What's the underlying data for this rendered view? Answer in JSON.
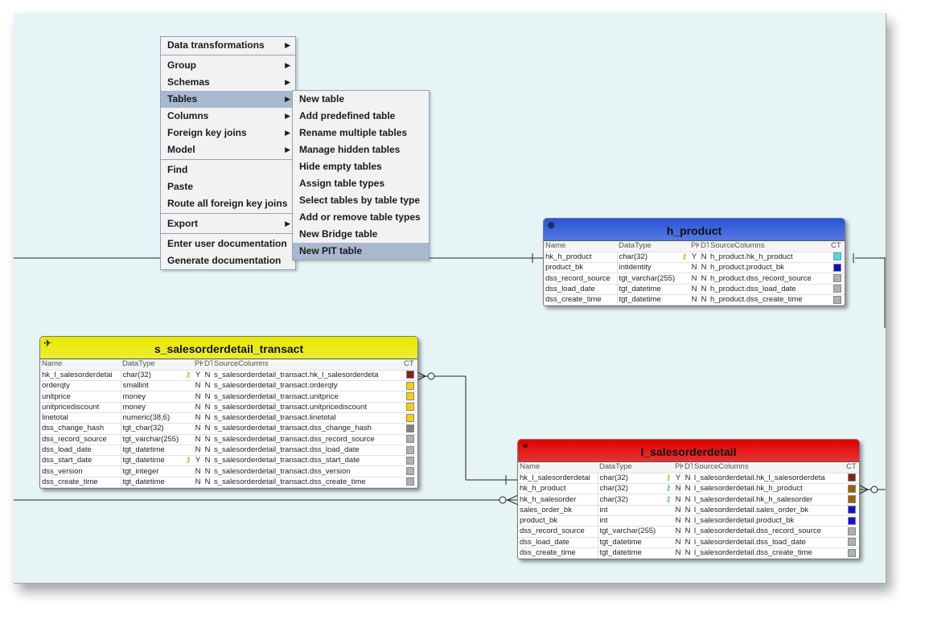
{
  "main_menu": {
    "items": [
      {
        "label": "Data transformations",
        "submenu": true
      },
      {
        "sep": true
      },
      {
        "label": "Group",
        "submenu": true
      },
      {
        "label": "Schemas",
        "submenu": true
      },
      {
        "label": "Tables",
        "submenu": true,
        "highlight": true
      },
      {
        "label": "Columns",
        "submenu": true
      },
      {
        "label": "Foreign key joins",
        "submenu": true
      },
      {
        "label": "Model",
        "submenu": true
      },
      {
        "sep": true
      },
      {
        "label": "Find"
      },
      {
        "label": "Paste"
      },
      {
        "label": "Route all foreign key joins"
      },
      {
        "sep": true
      },
      {
        "label": "Export",
        "submenu": true
      },
      {
        "sep": true
      },
      {
        "label": "Enter user documentation"
      },
      {
        "label": "Generate documentation"
      }
    ]
  },
  "tables_submenu": {
    "items": [
      {
        "label": "New table"
      },
      {
        "label": "Add predefined table"
      },
      {
        "label": "Rename multiple tables"
      },
      {
        "label": "Manage hidden tables"
      },
      {
        "label": "Hide empty tables"
      },
      {
        "label": "Assign table types"
      },
      {
        "label": "Select tables by table type"
      },
      {
        "label": "Add or remove table types"
      },
      {
        "label": "New Bridge table"
      },
      {
        "label": "New PIT table",
        "highlight": true
      }
    ]
  },
  "entities": {
    "h_product": {
      "title": "h_product",
      "header_color": "#2a55d8",
      "icon": "globe-icon",
      "columns": [
        "Name",
        "DataType",
        "PK",
        "DT",
        "SourceColumns",
        "CT"
      ],
      "rows": [
        {
          "name": "hk_h_product",
          "type": "char(32)",
          "key": "gold",
          "pk": "Y",
          "dt": "N",
          "src": "h_product.hk_h_product",
          "ct": "#40e0e8"
        },
        {
          "name": "product_bk",
          "type": "intidentity",
          "key": "",
          "pk": "N",
          "dt": "N",
          "src": "h_product.product_bk",
          "ct": "#1010c0"
        },
        {
          "name": "dss_record_source",
          "type": "tgt_varchar(255)",
          "key": "",
          "pk": "N",
          "dt": "N",
          "src": "h_product.dss_record_source",
          "ct": "#b0b0b0"
        },
        {
          "name": "dss_load_date",
          "type": "tgt_datetime",
          "key": "",
          "pk": "N",
          "dt": "N",
          "src": "h_product.dss_load_date",
          "ct": "#b0b0b0"
        },
        {
          "name": "dss_create_time",
          "type": "tgt_datetime",
          "key": "",
          "pk": "N",
          "dt": "N",
          "src": "h_product.dss_create_time",
          "ct": "#b0b0b0"
        }
      ]
    },
    "s_sales": {
      "title": "s_salesorderdetail_transact",
      "header_color": "#e8e800",
      "icon": "satellite-icon",
      "columns": [
        "Name",
        "DataType",
        "PK",
        "DT",
        "SourceColumns",
        "CT"
      ],
      "rows": [
        {
          "name": "hk_l_salesorderdetai",
          "type": "char(32)",
          "key": "gold",
          "pk": "Y",
          "dt": "N",
          "src": "s_salesorderdetail_transact.hk_l_salesorderdeta",
          "ct": "#8b2010"
        },
        {
          "name": "orderqty",
          "type": "smallint",
          "key": "",
          "pk": "N",
          "dt": "N",
          "src": "s_salesorderdetail_transact.orderqty",
          "ct": "#ffd000"
        },
        {
          "name": "unitprice",
          "type": "money",
          "key": "",
          "pk": "N",
          "dt": "N",
          "src": "s_salesorderdetail_transact.unitprice",
          "ct": "#ffd000"
        },
        {
          "name": "unitpricediscount",
          "type": "money",
          "key": "",
          "pk": "N",
          "dt": "N",
          "src": "s_salesorderdetail_transact.unitpricediscount",
          "ct": "#ffd000"
        },
        {
          "name": "linetotal",
          "type": "numeric(38,6)",
          "key": "",
          "pk": "N",
          "dt": "N",
          "src": "s_salesorderdetail_transact.linetotal",
          "ct": "#ffd000"
        },
        {
          "name": "dss_change_hash",
          "type": "tgt_char(32)",
          "key": "",
          "pk": "N",
          "dt": "N",
          "src": "s_salesorderdetail_transact.dss_change_hash",
          "ct": "#808080"
        },
        {
          "name": "dss_record_source",
          "type": "tgt_varchar(255)",
          "key": "",
          "pk": "N",
          "dt": "N",
          "src": "s_salesorderdetail_transact.dss_record_source",
          "ct": "#b0b0b0"
        },
        {
          "name": "dss_load_date",
          "type": "tgt_datetime",
          "key": "",
          "pk": "N",
          "dt": "N",
          "src": "s_salesorderdetail_transact.dss_load_date",
          "ct": "#b0b0b0"
        },
        {
          "name": "dss_start_date",
          "type": "tgt_datetime",
          "key": "gold",
          "pk": "Y",
          "dt": "N",
          "src": "s_salesorderdetail_transact.dss_start_date",
          "ct": "#b0b0b0"
        },
        {
          "name": "dss_version",
          "type": "tgt_integer",
          "key": "",
          "pk": "N",
          "dt": "N",
          "src": "s_salesorderdetail_transact.dss_version",
          "ct": "#b0b0b0"
        },
        {
          "name": "dss_create_time",
          "type": "tgt_datetime",
          "key": "",
          "pk": "N",
          "dt": "N",
          "src": "s_salesorderdetail_transact.dss_create_time",
          "ct": "#b0b0b0"
        }
      ]
    },
    "l_sales": {
      "title": "l_salesorderdetail",
      "header_color": "#e00000",
      "icon": "link-icon",
      "columns": [
        "Name",
        "DataType",
        "PK",
        "DT",
        "SourceColumns",
        "CT"
      ],
      "rows": [
        {
          "name": "hk_l_salesorderdetai",
          "type": "char(32)",
          "key": "gold",
          "pk": "Y",
          "dt": "N",
          "src": "l_salesorderdetail.hk_l_salesorderdeta",
          "ct": "#8b2010"
        },
        {
          "name": "hk_h_product",
          "type": "char(32)",
          "key": "blue",
          "pk": "N",
          "dt": "N",
          "src": "l_salesorderdetail.hk_h_product",
          "ct": "#a06000"
        },
        {
          "name": "hk_h_salesorder",
          "type": "char(32)",
          "key": "blue",
          "pk": "N",
          "dt": "N",
          "src": "l_salesorderdetail.hk_h_salesorder",
          "ct": "#a06000"
        },
        {
          "name": "sales_order_bk",
          "type": "int",
          "key": "",
          "pk": "N",
          "dt": "N",
          "src": "l_salesorderdetail.sales_order_bk",
          "ct": "#1010e0"
        },
        {
          "name": "product_bk",
          "type": "int",
          "key": "",
          "pk": "N",
          "dt": "N",
          "src": "l_salesorderdetail.product_bk",
          "ct": "#1010e0"
        },
        {
          "name": "dss_record_source",
          "type": "tgt_varchar(255)",
          "key": "",
          "pk": "N",
          "dt": "N",
          "src": "l_salesorderdetail.dss_record_source",
          "ct": "#b0b0b0"
        },
        {
          "name": "dss_load_date",
          "type": "tgt_datetime",
          "key": "",
          "pk": "N",
          "dt": "N",
          "src": "l_salesorderdetail.dss_load_date",
          "ct": "#b0b0b0"
        },
        {
          "name": "dss_create_time",
          "type": "tgt_datetime",
          "key": "",
          "pk": "N",
          "dt": "N",
          "src": "l_salesorderdetail.dss_create_time",
          "ct": "#b0b0b0"
        }
      ]
    }
  }
}
